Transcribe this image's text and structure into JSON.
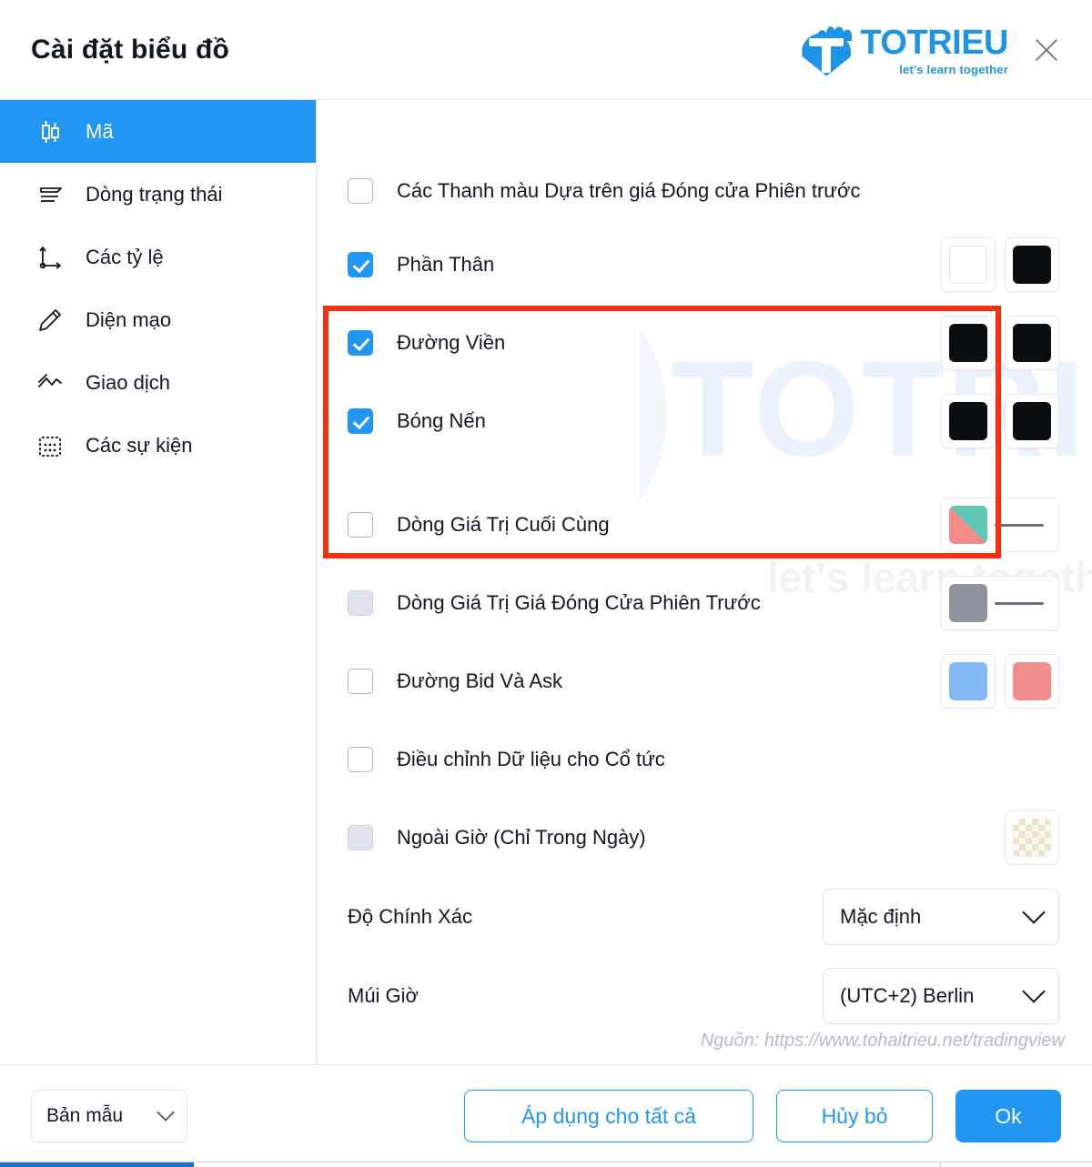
{
  "header": {
    "title": "Cài đặt biểu đồ",
    "logo_name": "TOTRIEU",
    "logo_tagline": "let's learn together",
    "close_label": "×"
  },
  "watermark": {
    "text": "TOTRIEU",
    "subtext": "let's learn together"
  },
  "sidebar": {
    "items": [
      {
        "label": "Mã",
        "icon": "candlestick-icon",
        "active": true
      },
      {
        "label": "Dòng trạng thái",
        "icon": "status-line-icon",
        "active": false
      },
      {
        "label": "Các tỷ lệ",
        "icon": "scales-axis-icon",
        "active": false
      },
      {
        "label": "Diện mạo",
        "icon": "pencil-icon",
        "active": false
      },
      {
        "label": "Giao dịch",
        "icon": "trading-zigzag-icon",
        "active": false
      },
      {
        "label": "Các sự kiện",
        "icon": "calendar-icon",
        "active": false
      }
    ]
  },
  "main": {
    "rows": [
      {
        "label": "Các Thanh màu Dựa trên giá Đóng cửa Phiên trước",
        "checkbox": "unchecked",
        "swatches": []
      },
      {
        "label": "Phần Thân",
        "checkbox": "checked",
        "swatches": [
          {
            "type": "color",
            "color": "#ffffff",
            "name": "body-up-color"
          },
          {
            "type": "color",
            "color": "#0b0e11",
            "name": "body-down-color"
          }
        ]
      },
      {
        "label": "Đường Viền",
        "checkbox": "checked",
        "swatches": [
          {
            "type": "color",
            "color": "#0b0e11",
            "name": "border-up-color"
          },
          {
            "type": "color",
            "color": "#0b0e11",
            "name": "border-down-color"
          }
        ]
      },
      {
        "label": "Bóng Nến",
        "checkbox": "checked",
        "swatches": [
          {
            "type": "color",
            "color": "#0b0e11",
            "name": "wick-up-color"
          },
          {
            "type": "color",
            "color": "#0b0e11",
            "name": "wick-down-color"
          }
        ]
      },
      {
        "label": "Dòng Giá Trị Cuối Cùng",
        "checkbox": "unchecked",
        "swatches": [
          {
            "type": "line",
            "color": "split-green-red",
            "name": "last-value-line-style"
          }
        ]
      },
      {
        "label": "Dòng Giá Trị Giá Đóng Cửa Phiên Trước",
        "checkbox": "disabled",
        "swatches": [
          {
            "type": "line",
            "color": "#8e939e",
            "name": "prev-close-line-style"
          }
        ]
      },
      {
        "label": "Đường Bid Và Ask",
        "checkbox": "unchecked",
        "swatches": [
          {
            "type": "color",
            "color": "#82b9f5",
            "name": "bid-line-color"
          },
          {
            "type": "color",
            "color": "#f08e8e",
            "name": "ask-line-color"
          }
        ]
      },
      {
        "label": "Điều chỉnh Dữ liệu cho Cổ tức",
        "checkbox": "unchecked",
        "swatches": []
      },
      {
        "label": "Ngoài Giờ (Chỉ Trong Ngày)",
        "checkbox": "disabled",
        "swatches": [
          {
            "type": "checker",
            "color": "#fbf8ee",
            "name": "extended-hours-background"
          }
        ]
      }
    ],
    "selects": [
      {
        "label": "Độ Chính Xác",
        "value": "Mặc định",
        "name": "precision-select"
      },
      {
        "label": "Múi Giờ",
        "value": "(UTC+2) Berlin",
        "name": "timezone-select"
      }
    ],
    "source_note": "Nguồn: https://www.tohaitrieu.net/tradingview",
    "highlight_color": "#f52f10"
  },
  "footer": {
    "template_label": "Bản mẫu",
    "apply_all_label": "Áp dụng cho tất cả",
    "cancel_label": "Hủy bỏ",
    "ok_label": "Ok"
  },
  "colors": {
    "accent": "#2196f3",
    "highlight": "#f52f10",
    "text": "#131722",
    "border": "#e0e3eb"
  }
}
